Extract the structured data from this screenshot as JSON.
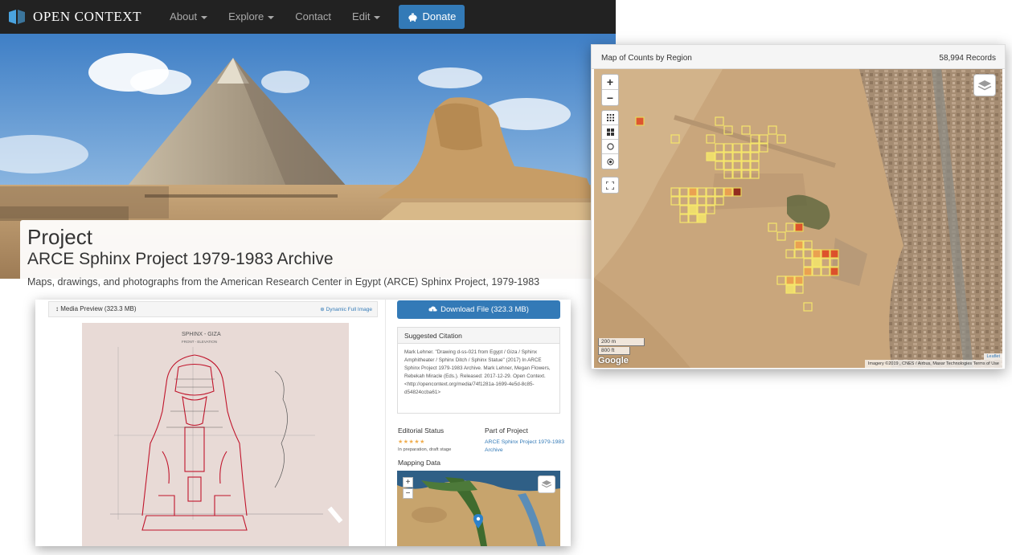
{
  "navbar": {
    "brand": "OPEN CONTEXT",
    "items": [
      {
        "label": "About",
        "dropdown": true
      },
      {
        "label": "Explore",
        "dropdown": true
      },
      {
        "label": "Contact",
        "dropdown": false
      },
      {
        "label": "Edit",
        "dropdown": true
      }
    ],
    "donate": "Donate"
  },
  "project": {
    "label": "Project",
    "title": "ARCE Sphinx Project 1979-1983 Archive",
    "description": "Maps, drawings, and photographs from the American Research Center in Egypt (ARCE) Sphinx Project, 1979-1983"
  },
  "media": {
    "preview_title": "Media Preview (323.3 MB)",
    "full_image_link": "Dynamic Full Image",
    "drawing_title": "SPHINX - GIZA",
    "drawing_subtitle": "FRONT - ELEVATION",
    "download_label": "Download File (323.3 MB)",
    "citation_heading": "Suggested Citation",
    "citation_text": "Mark Lehner. \"Drawing d-ss-021 from Egypt / Giza / Sphinx Amphitheater / Sphinx Ditch / Sphinx Statue\" (2017) In ARCE Sphinx Project 1979-1983 Archive. Mark Lehner, Megan Flowers, Rebekah Miracle (Eds.). Released: 2017-12-29. Open Context. <http://opencontext.org/media/74f1281a-1699-4e5d-8c85-d54824ccba61>",
    "editorial_label": "Editorial Status",
    "stars": "★★★★★",
    "editorial_stage": "In preparation, draft stage",
    "part_of_label": "Part of Project",
    "part_of_link": "ARCE Sphinx Project 1979-1983 Archive",
    "mapping_label": "Mapping Data",
    "zoom_in": "+",
    "zoom_out": "−"
  },
  "map": {
    "title": "Map of Counts by Region",
    "record_count": "58,994 Records",
    "zoom_in": "+",
    "zoom_out": "−",
    "scale_m": "200 m",
    "scale_ft": "800 ft",
    "google": "Google",
    "attribution": "Imagery ©2019 , CNES / Airbus, Maxar Technologies    Terms of Use",
    "leaflet": "Leaflet",
    "colors": {
      "low": "#f5e56b",
      "mid": "#f0a04a",
      "high": "#e0441e",
      "max": "#8b1a10"
    }
  }
}
